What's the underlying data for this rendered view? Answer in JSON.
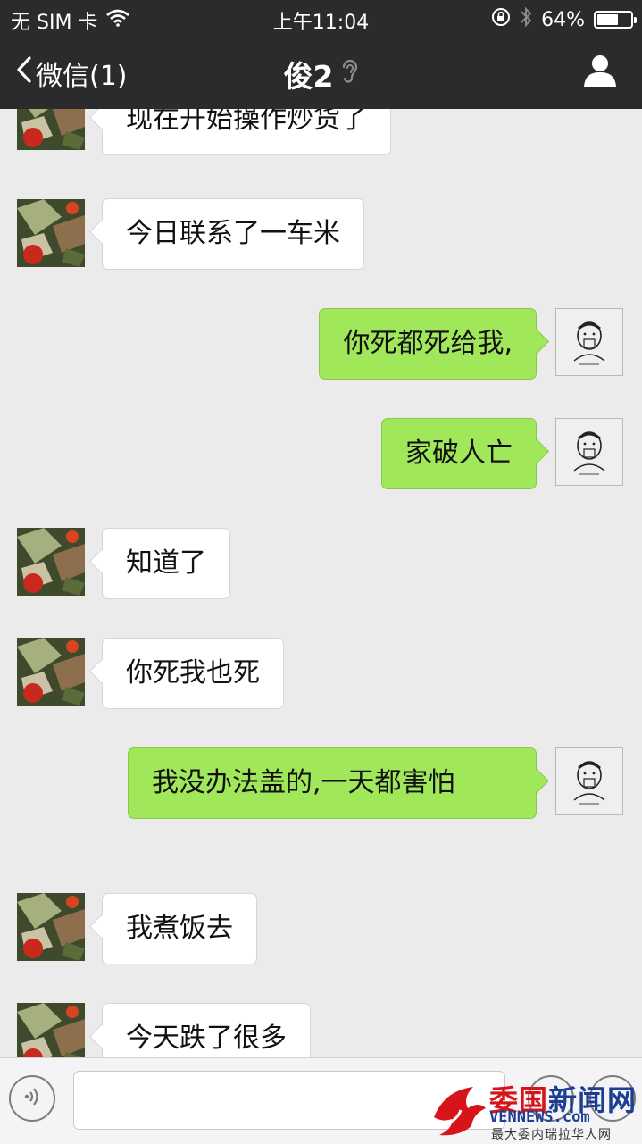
{
  "status_bar": {
    "carrier": "无 SIM 卡",
    "time": "上午11:04",
    "battery_percent": "64%",
    "battery_level": 0.64,
    "icons": [
      "wifi-icon",
      "orientation-lock-icon",
      "bluetooth-icon",
      "battery-icon"
    ]
  },
  "nav": {
    "back_label": "微信(1)",
    "title": "俊2",
    "icons": [
      "chevron-left-icon",
      "earpiece-icon",
      "person-icon"
    ]
  },
  "messages": [
    {
      "side": "in",
      "text": "现在开始操作炒货了"
    },
    {
      "side": "in",
      "text": "今日联系了一车米"
    },
    {
      "side": "out",
      "text": "你死都死给我,"
    },
    {
      "side": "out",
      "text": "家破人亡"
    },
    {
      "side": "in",
      "text": "知道了"
    },
    {
      "side": "in",
      "text": "你死我也死"
    },
    {
      "side": "out",
      "text": "我没办法盖的,一天都害怕"
    },
    {
      "side": "in",
      "text": "我煮饭去"
    },
    {
      "side": "in",
      "text": "今天跌了很多"
    }
  ],
  "input_bar": {
    "icons": [
      "voice-icon",
      "emoji-icon",
      "plus-icon"
    ]
  },
  "watermark": {
    "title_red": "委国",
    "title_blue": "新闻网",
    "domain": "VENNEWS.com",
    "tagline": "最大委内瑞拉华人网"
  },
  "colors": {
    "nav_background": "#2b2b2d",
    "chat_background": "#ebebeb",
    "outgoing_bubble": "#a0e75a",
    "incoming_bubble": "#ffffff"
  }
}
